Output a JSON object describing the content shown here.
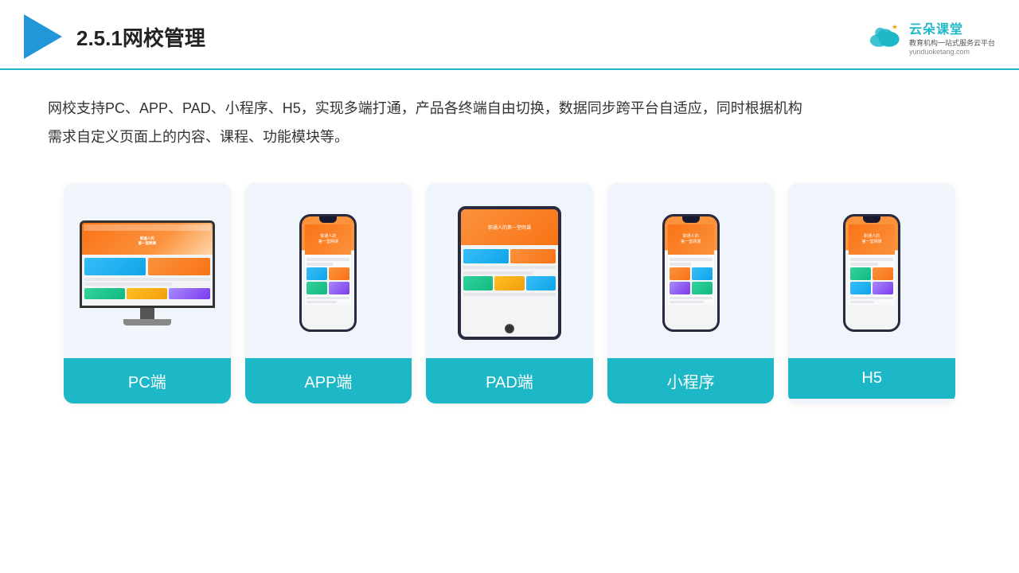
{
  "header": {
    "title": "2.5.1网校管理",
    "brand_name": "云朵课堂",
    "brand_slogan": "教育机构一站式服务云平台",
    "brand_url": "yunduoketang.com"
  },
  "description": {
    "line1": "网校支持PC、APP、PAD、小程序、H5，实现多端打通，产品各终端自由切换，数据同步跨平台自适应，同时根据机构",
    "line2": "需求自定义页面上的内容、课程、功能模块等。"
  },
  "cards": [
    {
      "label": "PC端",
      "type": "pc"
    },
    {
      "label": "APP端",
      "type": "phone"
    },
    {
      "label": "PAD端",
      "type": "tablet"
    },
    {
      "label": "小程序",
      "type": "phone2"
    },
    {
      "label": "H5",
      "type": "phone3"
    }
  ]
}
